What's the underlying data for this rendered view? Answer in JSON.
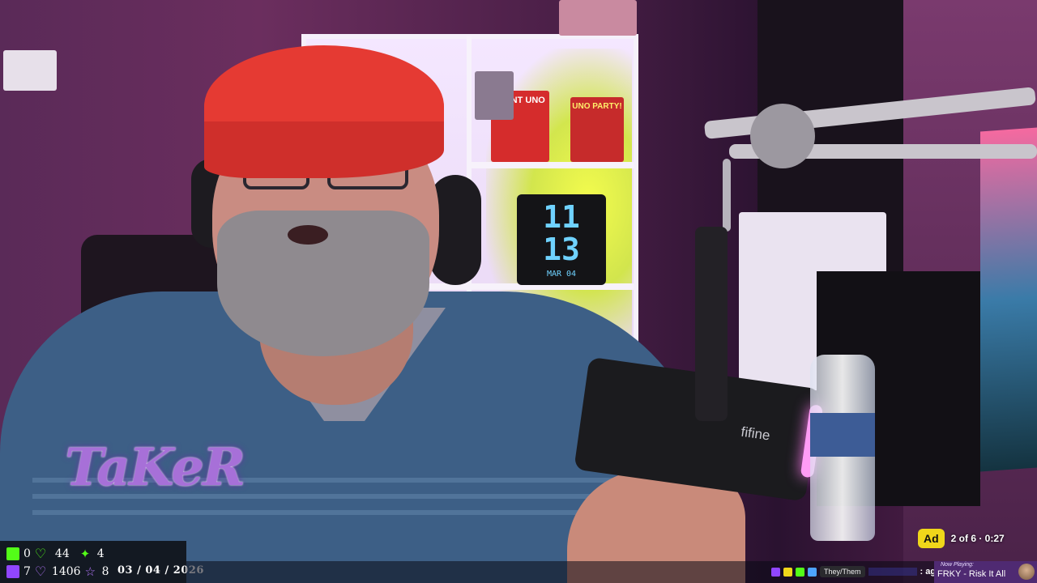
{
  "overlay": {
    "streamer_logo": "TaKeR",
    "date": "03 / 04 / 2026"
  },
  "stats": {
    "kick_followers": "0",
    "kick_likes": "44",
    "kick_subs": "4",
    "twitch_followers": "7",
    "twitch_likes": "1406",
    "twitch_subs": "8"
  },
  "ad": {
    "badge": "Ad",
    "progress": "2 of 6 · 0:27"
  },
  "chat": {
    "pronoun": "They/Them",
    "message": ": again"
  },
  "now_playing": {
    "label": "Now Playing:",
    "title": "FRKY - Risk It All"
  },
  "scene": {
    "clock_hour": "11",
    "clock_minute": "13",
    "clock_date": "MAR 04",
    "mic_brand": "fifine",
    "box1": "GIANT UNO",
    "box2": "UNO PARTY!"
  },
  "colors": {
    "kick_green": "#53fc18",
    "twitch_purple": "#9146ff",
    "ad_yellow": "#f0d71a",
    "now_playing_bg": "#4f2a72"
  }
}
